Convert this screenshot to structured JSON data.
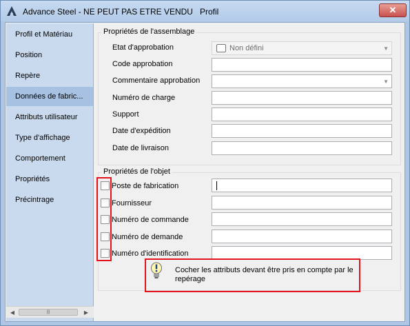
{
  "window": {
    "title": "Advance Steel - NE PEUT PAS ETRE VENDU   Profil",
    "close_symbol": "✕",
    "icon": "advance-steel-logo-icon"
  },
  "sidebar": {
    "items": [
      {
        "label": "Profil et Matériau"
      },
      {
        "label": "Position"
      },
      {
        "label": "Repère"
      },
      {
        "label": "Données de fabric..."
      },
      {
        "label": "Attributs utilisateur"
      },
      {
        "label": "Type d'affichage"
      },
      {
        "label": "Comportement"
      },
      {
        "label": "Propriétés"
      },
      {
        "label": "Précintrage"
      }
    ],
    "selected": "Données de fabric...",
    "scrollbar": {
      "left_arrow": "◀",
      "right_arrow": "▶",
      "thumb_grip": "|||"
    }
  },
  "assembly": {
    "title": "Propriétés de l'assemblage",
    "fields": [
      {
        "label": "Etat d'approbation",
        "value": "Non défini",
        "type": "combo"
      },
      {
        "label": "Code approbation",
        "value": "",
        "type": "text"
      },
      {
        "label": "Commentaire approbation",
        "value": "",
        "type": "combo"
      },
      {
        "label": "Numéro de charge",
        "value": "",
        "type": "text"
      },
      {
        "label": "Support",
        "value": "",
        "type": "text"
      },
      {
        "label": "Date d'expédition",
        "value": "",
        "type": "text"
      },
      {
        "label": "Date de livraison",
        "value": "",
        "type": "text"
      }
    ],
    "dropdown_arrow": "▼"
  },
  "object": {
    "title": "Propriétés de l'objet",
    "fields": [
      {
        "label": "Poste de fabrication",
        "value": "",
        "checked": false
      },
      {
        "label": "Fournisseur",
        "value": "",
        "checked": false
      },
      {
        "label": "Numéro de commande",
        "value": "",
        "checked": false
      },
      {
        "label": "Numéro de demande",
        "value": "",
        "checked": false
      },
      {
        "label": "Numéro d'identification",
        "value": "",
        "checked": false
      }
    ]
  },
  "hint": {
    "text": "Cocher les attributs devant être pris en compte par le repérage",
    "icon": "lightbulb-icon"
  },
  "colors": {
    "highlight_red": "#e4121b",
    "sidebar_bg": "#c9daee",
    "sidebar_selected": "#a6c1e1",
    "window_frame": "#aec6e4"
  }
}
